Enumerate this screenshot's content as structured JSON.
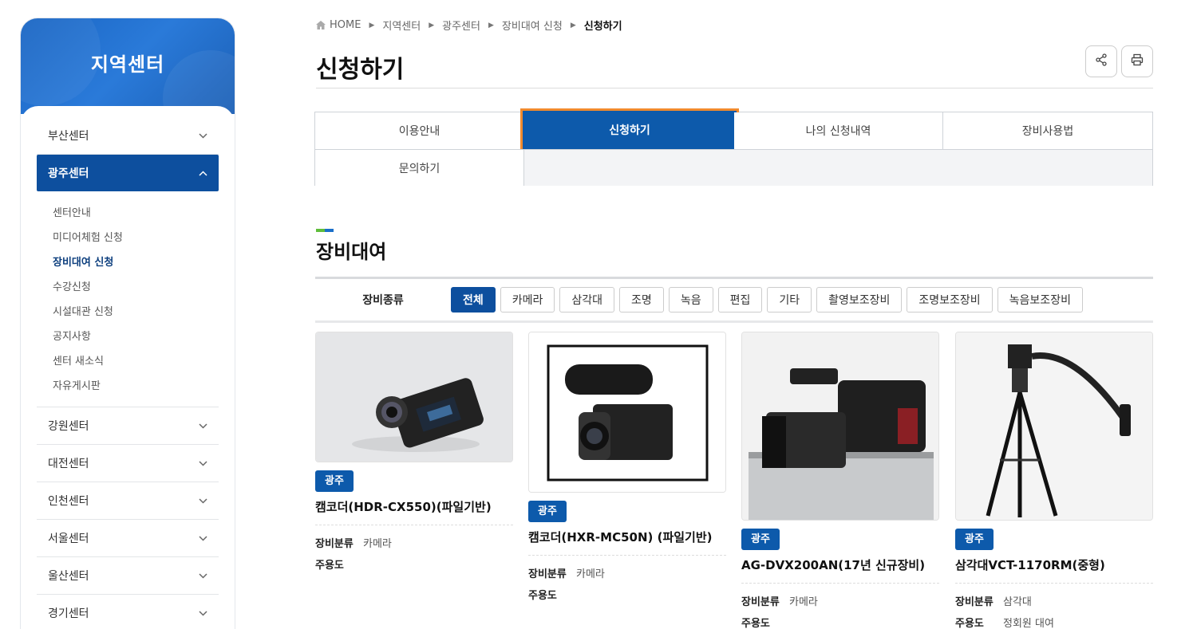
{
  "sidebar": {
    "title": "지역센터",
    "items": [
      {
        "label": "부산센터"
      },
      {
        "label": "광주센터"
      },
      {
        "label": "강원센터"
      },
      {
        "label": "대전센터"
      },
      {
        "label": "인천센터"
      },
      {
        "label": "서울센터"
      },
      {
        "label": "울산센터"
      },
      {
        "label": "경기센터"
      }
    ],
    "sub_items": [
      {
        "label": "센터안내"
      },
      {
        "label": "미디어체험 신청"
      },
      {
        "label": "장비대여 신청"
      },
      {
        "label": "수강신청"
      },
      {
        "label": "시설대관 신청"
      },
      {
        "label": "공지사항"
      },
      {
        "label": "센터 새소식"
      },
      {
        "label": "자유게시판"
      }
    ]
  },
  "breadcrumb": [
    "HOME",
    "지역센터",
    "광주센터",
    "장비대여 신청",
    "신청하기"
  ],
  "page_title": "신청하기",
  "tabs": [
    {
      "label": "이용안내"
    },
    {
      "label": "신청하기"
    },
    {
      "label": "나의 신청내역"
    },
    {
      "label": "장비사용법"
    },
    {
      "label": "문의하기"
    }
  ],
  "section_title": "장비대여",
  "filter": {
    "label": "장비종류",
    "options": [
      "전체",
      "카메라",
      "삼각대",
      "조명",
      "녹음",
      "편집",
      "기타",
      "촬영보조장비",
      "조명보조장비",
      "녹음보조장비"
    ],
    "selected": "전체"
  },
  "products": [
    {
      "badge": "광주",
      "name": "캠코더(HDR-CX550)(파일기반)",
      "category_label": "장비분류",
      "category": "카메라",
      "usage_label": "주용도",
      "usage": ""
    },
    {
      "badge": "광주",
      "name": "캠코더(HXR-MC50N) (파일기반)",
      "category_label": "장비분류",
      "category": "카메라",
      "usage_label": "주용도",
      "usage": ""
    },
    {
      "badge": "광주",
      "name": "AG-DVX200AN(17년 신규장비)",
      "category_label": "장비분류",
      "category": "카메라",
      "usage_label": "주용도",
      "usage": ""
    },
    {
      "badge": "광주",
      "name": "삼각대VCT-1170RM(중형)",
      "category_label": "장비분류",
      "category": "삼각대",
      "usage_label": "주용도",
      "usage": "정회원 대여"
    }
  ],
  "colors": {
    "primary": "#0d4f9e",
    "highlight": "#f08a2e"
  }
}
